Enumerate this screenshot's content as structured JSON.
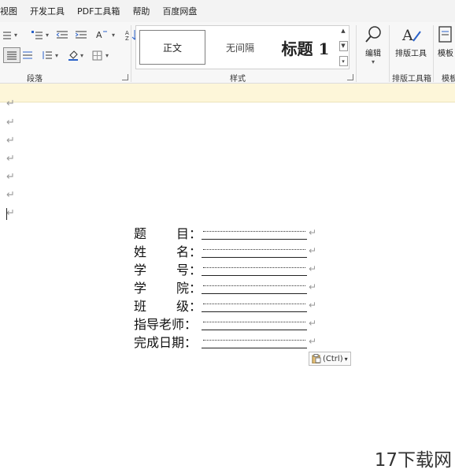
{
  "menubar": {
    "items": [
      "视图",
      "开发工具",
      "PDF工具箱",
      "帮助",
      "百度网盘"
    ]
  },
  "ribbon": {
    "paragraph_group_label": "段落",
    "styles_group_label": "样式",
    "layout_group_label": "排版工具箱",
    "template_group_label": "模板",
    "styles": [
      "正文",
      "无间隔",
      "标题 1"
    ],
    "edit_label": "编辑",
    "layout_tool_label": "排版工具",
    "template_label": "模板"
  },
  "document": {
    "empty_paragraph_mark": "↵",
    "form_rows": [
      {
        "label": [
          "题",
          "目："
        ]
      },
      {
        "label": [
          "姓",
          "名："
        ]
      },
      {
        "label": [
          "学",
          "号："
        ]
      },
      {
        "label": [
          "学",
          "院："
        ]
      },
      {
        "label": [
          "班",
          "级："
        ]
      },
      {
        "label": [
          "指导老师："
        ]
      },
      {
        "label": [
          "完成日期："
        ]
      }
    ],
    "paste_options_label": "(Ctrl)"
  },
  "watermark": "17下载网",
  "colors": {
    "menubar_bg": "#f3f3f3",
    "ribbon_bg": "#f7f7f7",
    "notice_bg": "#fdf6d9"
  }
}
